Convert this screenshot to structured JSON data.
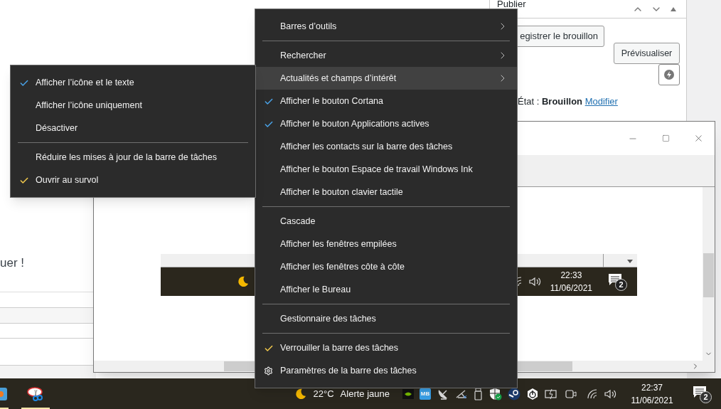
{
  "editor_page": {
    "text_fragment": "uer !"
  },
  "publish_panel": {
    "title": "Publier",
    "save_draft_button": "egistrer le brouillon",
    "preview_button": "Prévisualiser",
    "status_text": "État : **Brouillon**",
    "status_link": "Modifier"
  },
  "viewer_window": {
    "clock_time": "22:33",
    "clock_date": "11/06/2021",
    "notification_count": "2"
  },
  "context_menu": {
    "groups": [
      [
        {
          "label": "Barres d’outils",
          "kind": "submenu",
          "highlighted": false
        }
      ],
      [
        {
          "label": "Rechercher",
          "kind": "submenu",
          "highlighted": false
        },
        {
          "label": "Actualités et champs d’intérêt",
          "kind": "submenu",
          "highlighted": true
        },
        {
          "label": "Afficher le bouton Cortana",
          "kind": "check",
          "checked": true,
          "color": "#4aa3e8"
        },
        {
          "label": "Afficher le bouton Applications actives",
          "kind": "check",
          "checked": true,
          "color": "#4aa3e8"
        },
        {
          "label": "Afficher les contacts sur la barre des tâches",
          "kind": "check",
          "checked": false
        },
        {
          "label": "Afficher le bouton Espace de travail Windows Ink",
          "kind": "check",
          "checked": false
        },
        {
          "label": "Afficher le bouton clavier tactile",
          "kind": "check",
          "checked": false
        }
      ],
      [
        {
          "label": "Cascade",
          "kind": "plain"
        },
        {
          "label": "Afficher les fenêtres empilées",
          "kind": "plain"
        },
        {
          "label": "Afficher les fenêtres côte à côte",
          "kind": "plain"
        },
        {
          "label": "Afficher le Bureau",
          "kind": "plain"
        }
      ],
      [
        {
          "label": "Gestionnaire des tâches",
          "kind": "plain"
        }
      ],
      [
        {
          "label": "Verrouiller la barre des tâches",
          "kind": "check",
          "checked": true,
          "color": "#f2c94c"
        },
        {
          "label": "Paramètres de la barre des tâches",
          "kind": "settings"
        }
      ]
    ]
  },
  "submenu": {
    "groups": [
      [
        {
          "label": "Afficher l’icône et le texte",
          "kind": "check",
          "checked": true,
          "color": "#4aa3e8"
        },
        {
          "label": "Afficher l’icône uniquement",
          "kind": "check",
          "checked": false
        },
        {
          "label": "Désactiver",
          "kind": "check",
          "checked": false
        }
      ],
      [
        {
          "label": "Réduire les mises à jour de la barre de tâches",
          "kind": "check",
          "checked": false
        },
        {
          "label": "Ouvrir au survol",
          "kind": "check",
          "checked": true,
          "color": "#f2c94c"
        }
      ]
    ]
  },
  "taskbar": {
    "temperature": "22°C",
    "weather_alert": "Alerte jaune",
    "tray_label": "MB",
    "time": "22:37",
    "date": "11/06/2021",
    "notification_count": "2"
  }
}
